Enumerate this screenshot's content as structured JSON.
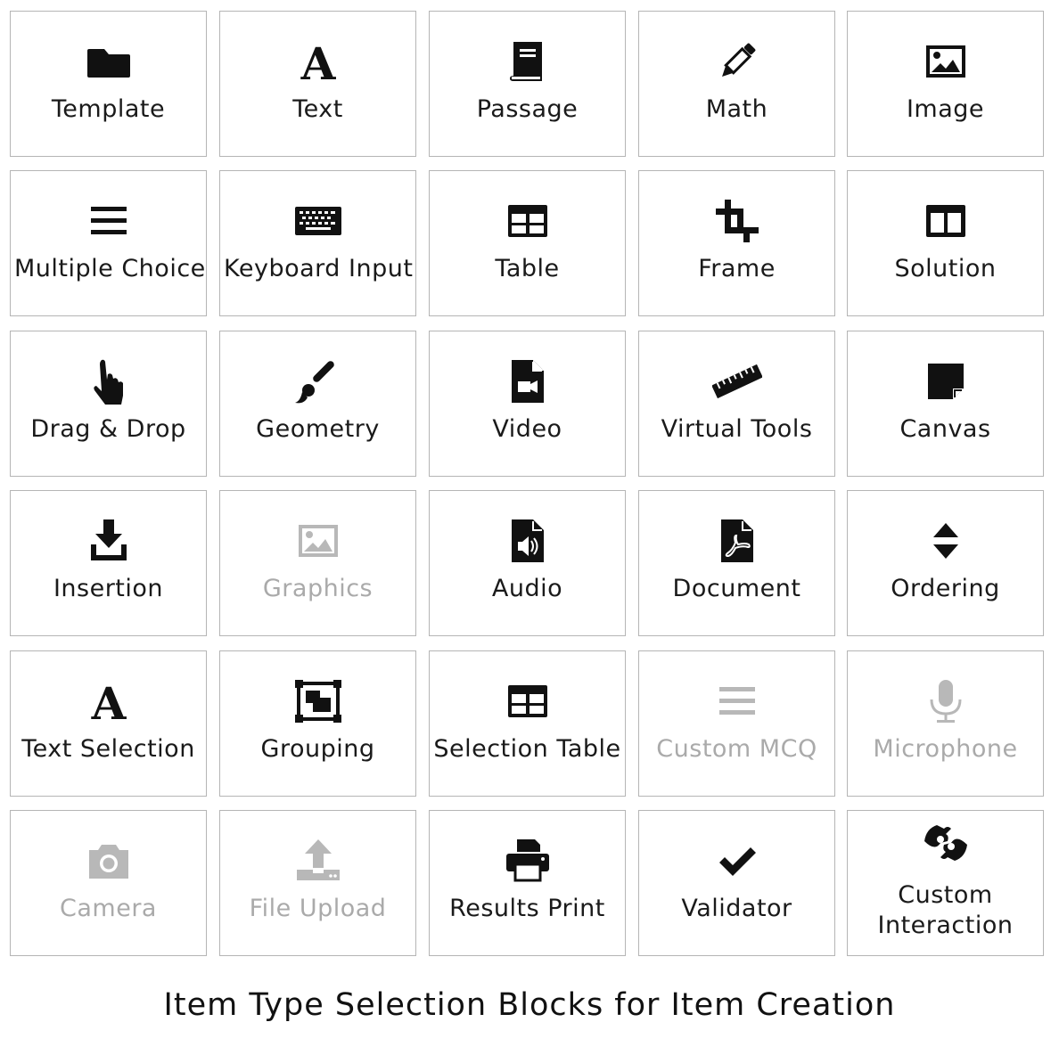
{
  "tiles": [
    {
      "label": "Template",
      "icon": "folder-icon",
      "name": "tile-template",
      "enabled": true
    },
    {
      "label": "Text",
      "icon": "text-a-icon",
      "name": "tile-text",
      "enabled": true
    },
    {
      "label": "Passage",
      "icon": "book-icon",
      "name": "tile-passage",
      "enabled": true
    },
    {
      "label": "Math",
      "icon": "pencil-icon",
      "name": "tile-math",
      "enabled": true
    },
    {
      "label": "Image",
      "icon": "image-icon",
      "name": "tile-image",
      "enabled": true
    },
    {
      "label": "Multiple Choice",
      "icon": "list-bars-icon",
      "name": "tile-multiple-choice",
      "enabled": true
    },
    {
      "label": "Keyboard Input",
      "icon": "keyboard-icon",
      "name": "tile-keyboard-input",
      "enabled": true
    },
    {
      "label": "Table",
      "icon": "table-icon",
      "name": "tile-table",
      "enabled": true
    },
    {
      "label": "Frame",
      "icon": "crop-icon",
      "name": "tile-frame",
      "enabled": true
    },
    {
      "label": "Solution",
      "icon": "columns-icon",
      "name": "tile-solution",
      "enabled": true
    },
    {
      "label": "Drag & Drop",
      "icon": "pointer-hand-icon",
      "name": "tile-drag-drop",
      "enabled": true
    },
    {
      "label": "Geometry",
      "icon": "paintbrush-icon",
      "name": "tile-geometry",
      "enabled": true
    },
    {
      "label": "Video",
      "icon": "video-file-icon",
      "name": "tile-video",
      "enabled": true
    },
    {
      "label": "Virtual Tools",
      "icon": "ruler-icon",
      "name": "tile-virtual-tools",
      "enabled": true
    },
    {
      "label": "Canvas",
      "icon": "sticky-note-icon",
      "name": "tile-canvas",
      "enabled": true
    },
    {
      "label": "Insertion",
      "icon": "download-icon",
      "name": "tile-insertion",
      "enabled": true
    },
    {
      "label": "Graphics",
      "icon": "image-icon",
      "name": "tile-graphics",
      "enabled": false
    },
    {
      "label": "Audio",
      "icon": "audio-file-icon",
      "name": "tile-audio",
      "enabled": true
    },
    {
      "label": "Document",
      "icon": "pdf-file-icon",
      "name": "tile-document",
      "enabled": true
    },
    {
      "label": "Ordering",
      "icon": "sort-arrows-icon",
      "name": "tile-ordering",
      "enabled": true
    },
    {
      "label": "Text Selection",
      "icon": "text-a-icon",
      "name": "tile-text-selection",
      "enabled": true
    },
    {
      "label": "Grouping",
      "icon": "group-objects-icon",
      "name": "tile-grouping",
      "enabled": true
    },
    {
      "label": "Selection Table",
      "icon": "table-icon",
      "name": "tile-selection-table",
      "enabled": true
    },
    {
      "label": "Custom MCQ",
      "icon": "list-bars-icon",
      "name": "tile-custom-mcq",
      "enabled": false
    },
    {
      "label": "Microphone",
      "icon": "microphone-icon",
      "name": "tile-microphone",
      "enabled": false
    },
    {
      "label": "Camera",
      "icon": "camera-icon",
      "name": "tile-camera",
      "enabled": false
    },
    {
      "label": "File Upload",
      "icon": "upload-icon",
      "name": "tile-file-upload",
      "enabled": false
    },
    {
      "label": "Results Print",
      "icon": "printer-icon",
      "name": "tile-results-print",
      "enabled": true
    },
    {
      "label": "Validator",
      "icon": "checkmark-icon",
      "name": "tile-validator",
      "enabled": true
    },
    {
      "label": "Custom Interaction",
      "icon": "sign-language-icon",
      "name": "tile-custom-interaction",
      "enabled": true
    }
  ],
  "caption": "Item Type Selection Blocks for Item Creation"
}
